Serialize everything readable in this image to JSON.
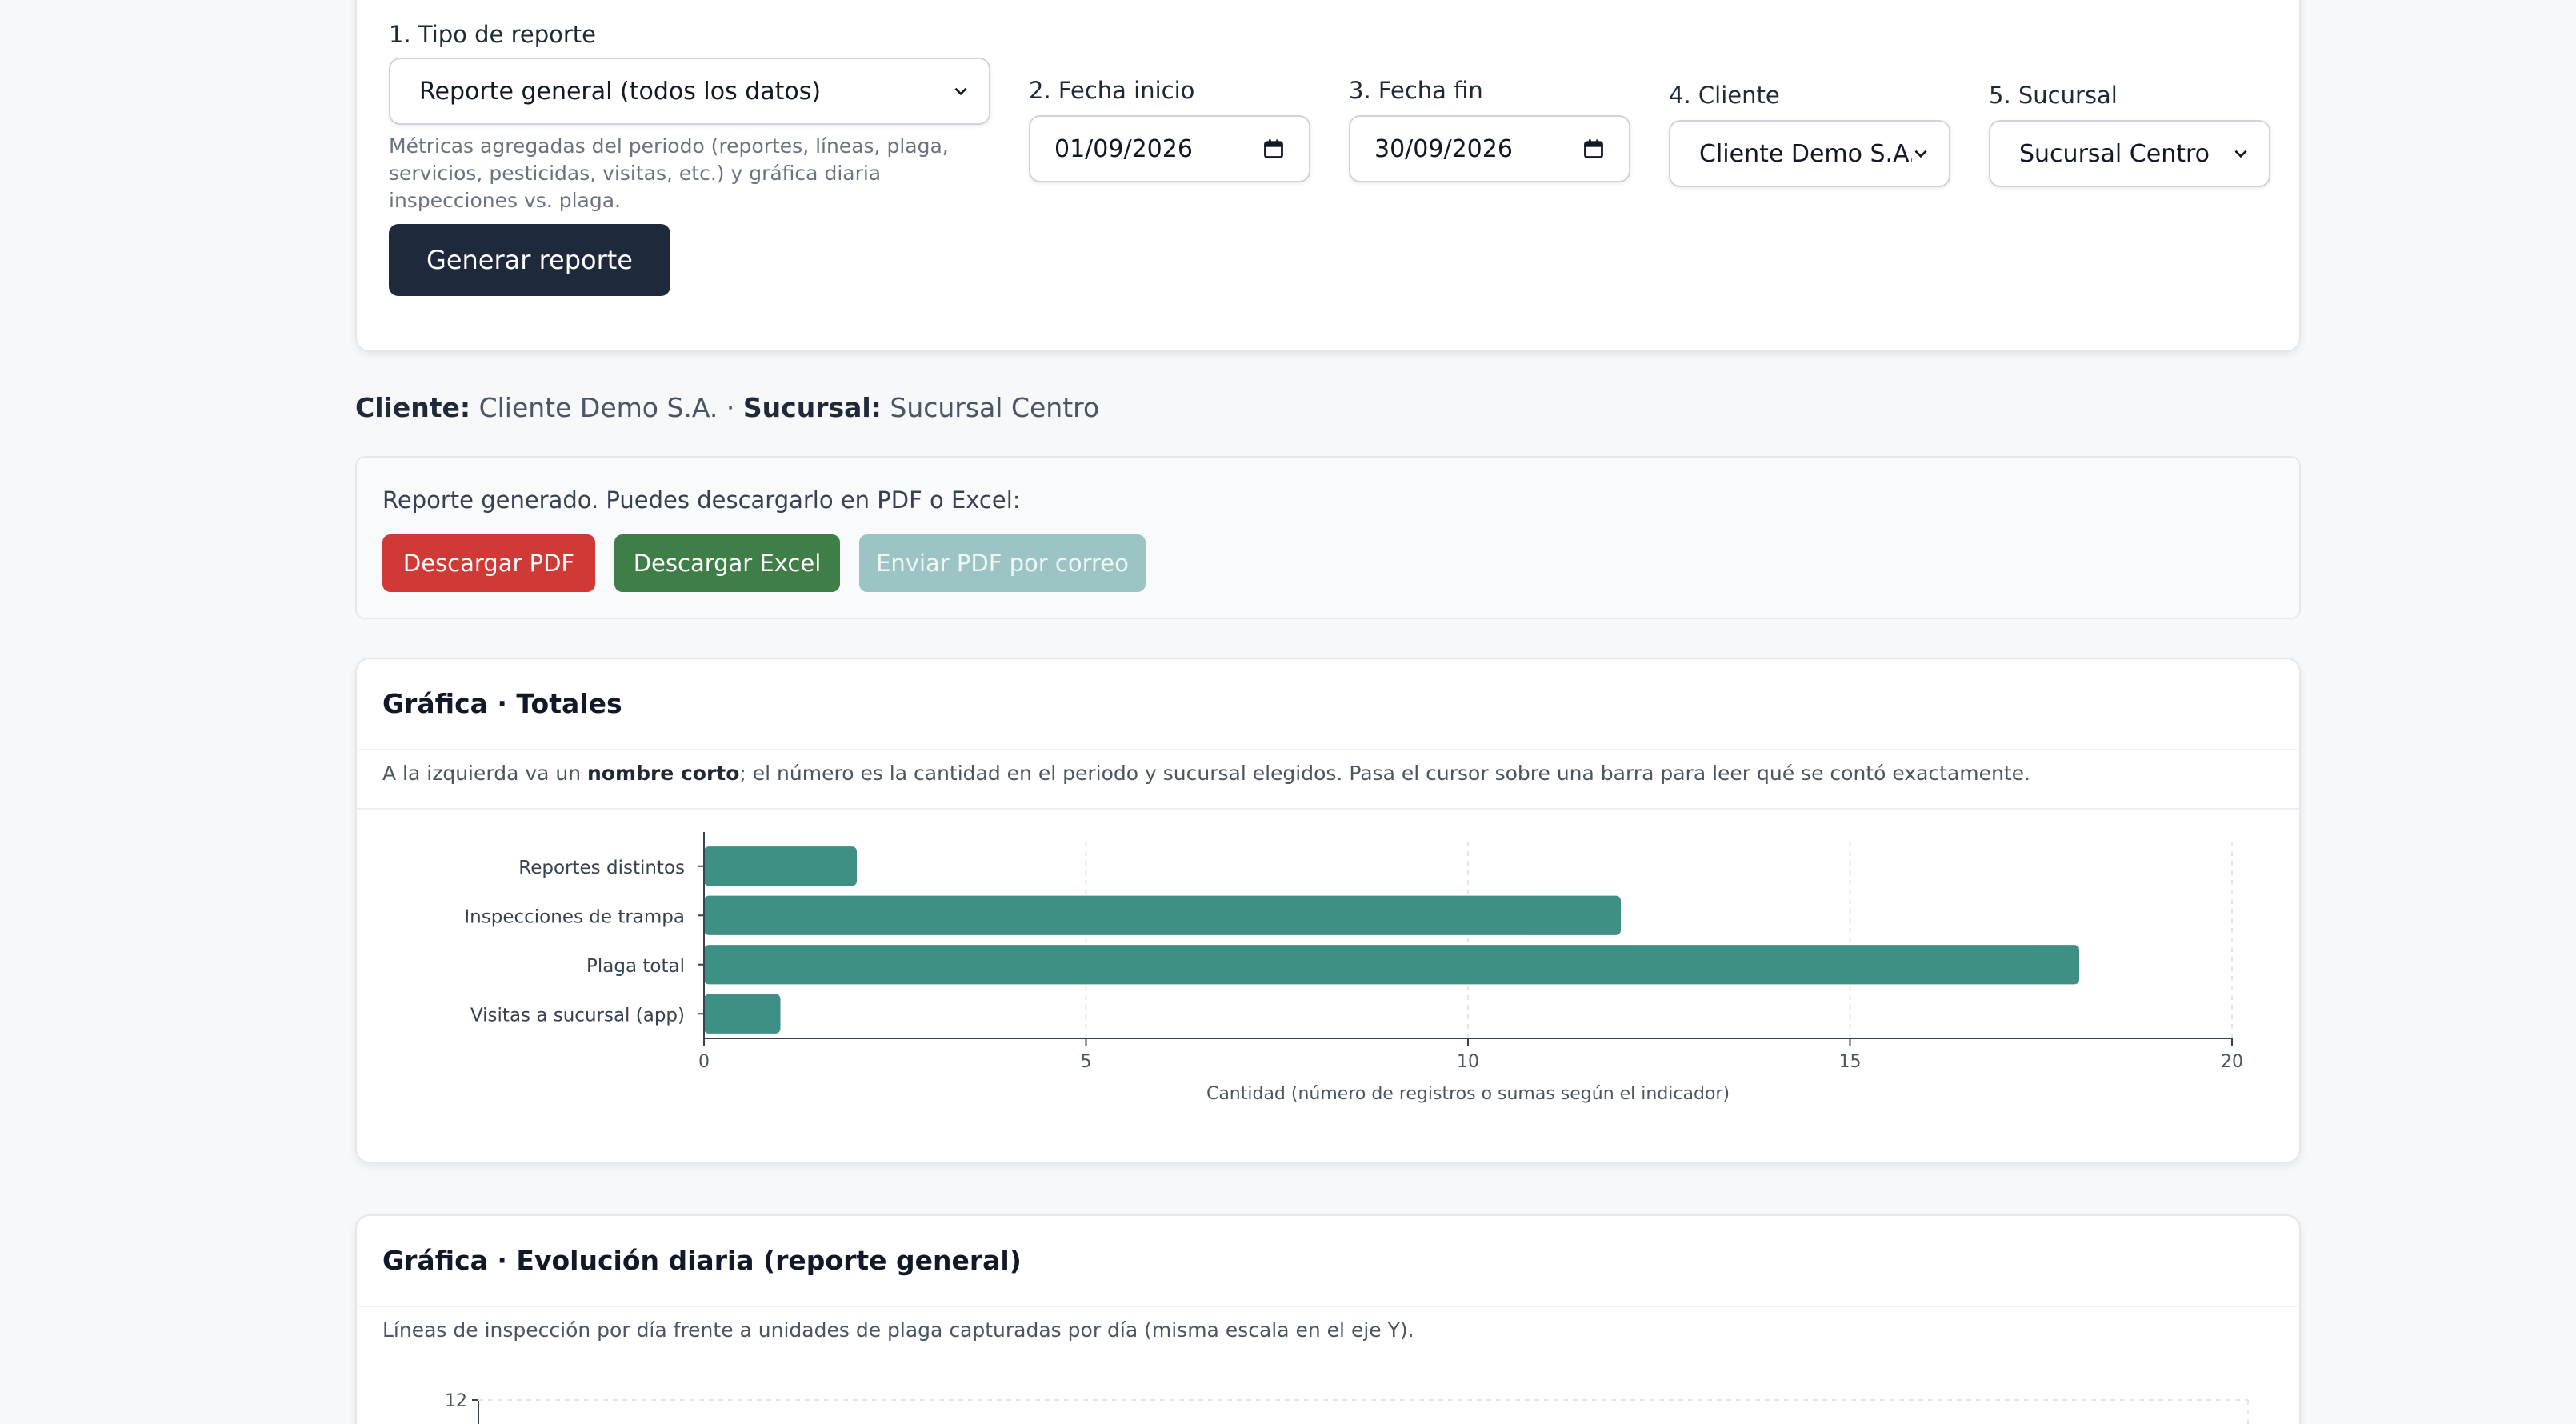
{
  "form": {
    "report_type": {
      "label": "1. Tipo de reporte",
      "value": "Reporte general (todos los datos)",
      "hint": "Métricas agregadas del periodo (reportes, líneas, plaga, servicios, pesticidas, visitas, etc.) y gráfica diaria inspecciones vs. plaga."
    },
    "start_date": {
      "label": "2. Fecha inicio",
      "value": "01/09/2026"
    },
    "end_date": {
      "label": "3. Fecha fin",
      "value": "30/09/2026"
    },
    "client": {
      "label": "4. Cliente",
      "value": "Cliente Demo S.A."
    },
    "branch": {
      "label": "5. Sucursal",
      "value": "Sucursal Centro"
    },
    "generate_label": "Generar reporte"
  },
  "summary": {
    "client_label": "Cliente:",
    "client_value": "Cliente Demo S.A.",
    "separator": "·",
    "branch_label": "Sucursal:",
    "branch_value": "Sucursal Centro"
  },
  "download": {
    "message": "Reporte generado. Puedes descargarlo en PDF o Excel:",
    "pdf_label": "Descargar PDF",
    "excel_label": "Descargar Excel",
    "email_label": "Enviar PDF por correo",
    "colors": {
      "pdf": "#d03a36",
      "excel": "#3f7f47",
      "email": "#9cc4c4"
    }
  },
  "totals_card": {
    "title": "Gráfica · Totales",
    "desc_prefix": "A la izquierda va un ",
    "desc_bold": "nombre corto",
    "desc_suffix": "; el número es la cantidad en el periodo y sucursal elegidos. Pasa el cursor sobre una barra para leer qué se contó exactamente."
  },
  "daily_card": {
    "title": "Gráfica · Evolución diaria (reporte general)",
    "desc": "Líneas de inspección por día frente a unidades de plaga capturadas por día (misma escala en el eje Y)."
  },
  "chart_data": [
    {
      "type": "bar",
      "orientation": "horizontal",
      "categories": [
        "Reportes distintos",
        "Inspecciones de trampa",
        "Plaga total",
        "Visitas a sucursal (app)"
      ],
      "values": [
        2,
        12,
        18,
        1
      ],
      "xlabel": "Cantidad (número de registros o sumas según el indicador)",
      "xlim": [
        0,
        20
      ],
      "xticks": [
        0,
        5,
        10,
        15,
        20
      ],
      "grid": true,
      "bar_color": "#3f9084"
    },
    {
      "type": "line",
      "ylim": [
        0,
        12
      ],
      "yticks_visible": [
        12
      ]
    }
  ]
}
